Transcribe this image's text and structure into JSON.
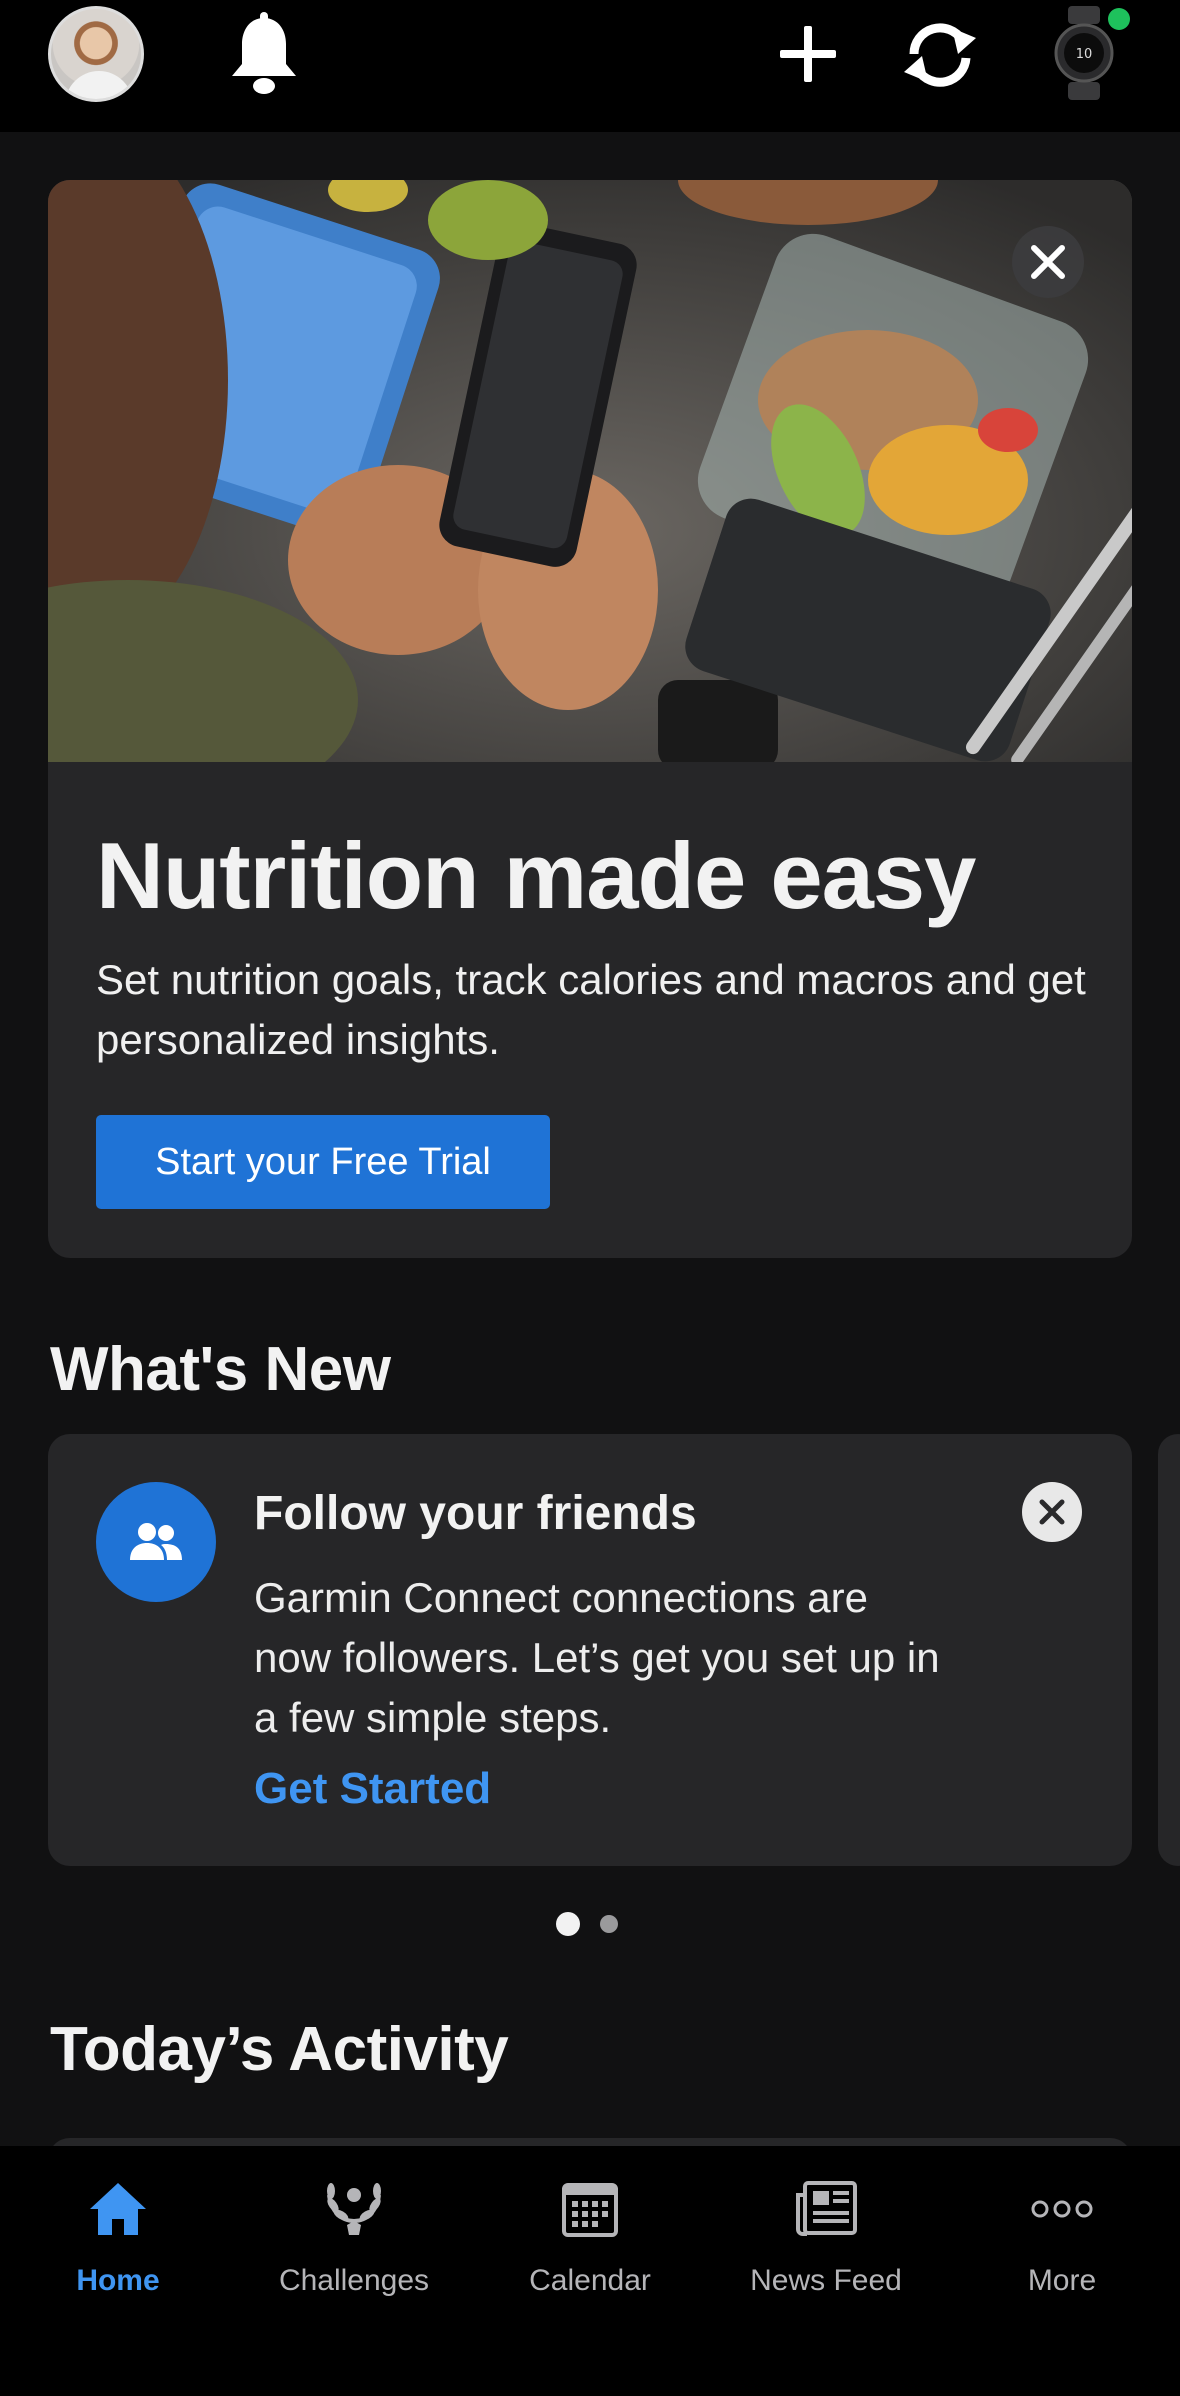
{
  "topbar": {
    "avatar": "profile-avatar",
    "icons": [
      "bell-icon",
      "plus-icon",
      "sync-icon",
      "watch-icon"
    ],
    "watch_status_color": "#1ec15c"
  },
  "promo": {
    "image": "nutrition-app-on-phone-photo",
    "title": "Nutrition made easy",
    "description": "Set nutrition goals, track calories and macros and get personalized insights.",
    "button_label": "Start your Free Trial",
    "accent_color": "#1f73d6"
  },
  "whats_new": {
    "title": "What's New",
    "card": {
      "icon": "friends-icon",
      "title": "Follow your friends",
      "description": "Garmin Connect connections are now followers. Let’s get you set up in a few simple steps.",
      "link_label": "Get Started",
      "link_color": "#3f95f2"
    },
    "pager": {
      "current": 1,
      "total": 2
    }
  },
  "todays_activity": {
    "title": "Today’s Activity"
  },
  "tabbar": {
    "items": [
      {
        "label": "Home",
        "icon": "home-icon",
        "active": true
      },
      {
        "label": "Challenges",
        "icon": "laurel-icon",
        "active": false
      },
      {
        "label": "Calendar",
        "icon": "calendar-icon",
        "active": false
      },
      {
        "label": "News Feed",
        "icon": "newspaper-icon",
        "active": false
      },
      {
        "label": "More",
        "icon": "more-icon",
        "active": false
      }
    ]
  }
}
